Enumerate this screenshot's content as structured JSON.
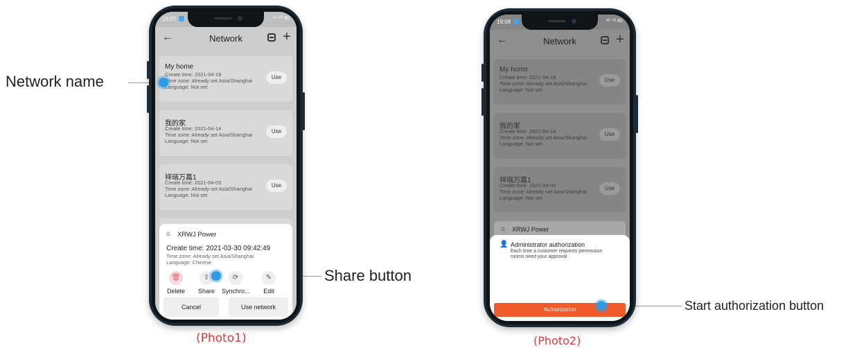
{
  "callouts": {
    "network_name": "Network name",
    "share_button": "Share button",
    "start_authorization": "Start authorization button"
  },
  "captions": {
    "photo1": "(Photo1)",
    "photo2": "(Photo2)"
  },
  "colors": {
    "accent_orange": "#f15a2b",
    "highlight_blue": "#2f9be3",
    "caption_red": "#e0393e"
  },
  "phone1": {
    "status_time": "19:07",
    "status_right": "⁴ᴳ ⁴ᴳ 60",
    "title": "Network",
    "networks": [
      {
        "name": "My home",
        "create": "Create time: 2021-04-19",
        "tz": "Time zone: Already set Asia/Shanghai",
        "lang": "Language: Not set",
        "use": "Use"
      },
      {
        "name": "我的家",
        "create": "Create time: 2021-04-14",
        "tz": "Time zone: Already set Asia/Shanghai",
        "lang": "Language: Not set",
        "use": "Use"
      },
      {
        "name": "祥瑞万嘉1",
        "create": "Create time: 2021-04-03",
        "tz": "Time zone: Already set Asia/Shanghai",
        "lang": "Language: Not set",
        "use": "Use"
      }
    ],
    "sheet": {
      "name": "XRWJ Power",
      "create": "Create time: 2021-03-30  09:42:49",
      "tz": "Time zone: Already set Asia/Shanghai",
      "lang": "Language: Chinese",
      "actions": [
        "Delete",
        "Share",
        "Synchro...",
        "Edit"
      ],
      "cancel": "Cancel",
      "use_network": "Use network"
    }
  },
  "phone2": {
    "status_time": "19:08",
    "status_right": "⁴ᴳ ⁴ᴳ 60",
    "title": "Network",
    "networks": [
      {
        "name": "My home",
        "create": "Create time: 2021-04-19",
        "tz": "Time zone: Already set Asia/Shanghai",
        "lang": "Language: Not set",
        "use": "Use"
      },
      {
        "name": "我的家",
        "create": "Create time: 2021-04-14",
        "tz": "Time zone: Already set Asia/Shanghai",
        "lang": "Language: Not set",
        "use": "Use"
      },
      {
        "name": "祥瑞万嘉1",
        "create": "Create time: 2021-04-03",
        "tz": "Time zone: Already set Asia/Shanghai",
        "lang": "Language: Not set",
        "use": "Use"
      }
    ],
    "peek_name": "XRWJ Power",
    "auth": {
      "title": "Administrator authorization",
      "desc1": "Each time a customer requests permission",
      "desc2": "rooms need your approval",
      "button": "Authorization"
    }
  }
}
